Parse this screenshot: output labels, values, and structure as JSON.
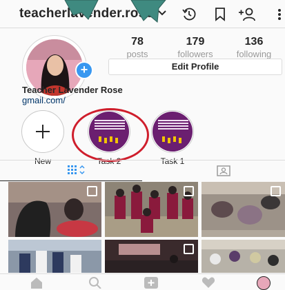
{
  "header": {
    "username": "teacherlavender.rose"
  },
  "profile": {
    "stats": [
      {
        "value": "78",
        "label": "posts"
      },
      {
        "value": "179",
        "label": "followers"
      },
      {
        "value": "136",
        "label": "following"
      }
    ],
    "edit_label": "Edit Profile",
    "display_name": "Teacher Lavender Rose",
    "link": "gmail.com/"
  },
  "highlights": [
    {
      "label": "New"
    },
    {
      "label": "Task 2"
    },
    {
      "label": "Task 1"
    }
  ],
  "colors": {
    "accent": "#3897f0",
    "annotation": "#cf1e2c",
    "arrow": "#3f8a80",
    "story_bg": "#6b1f70"
  }
}
